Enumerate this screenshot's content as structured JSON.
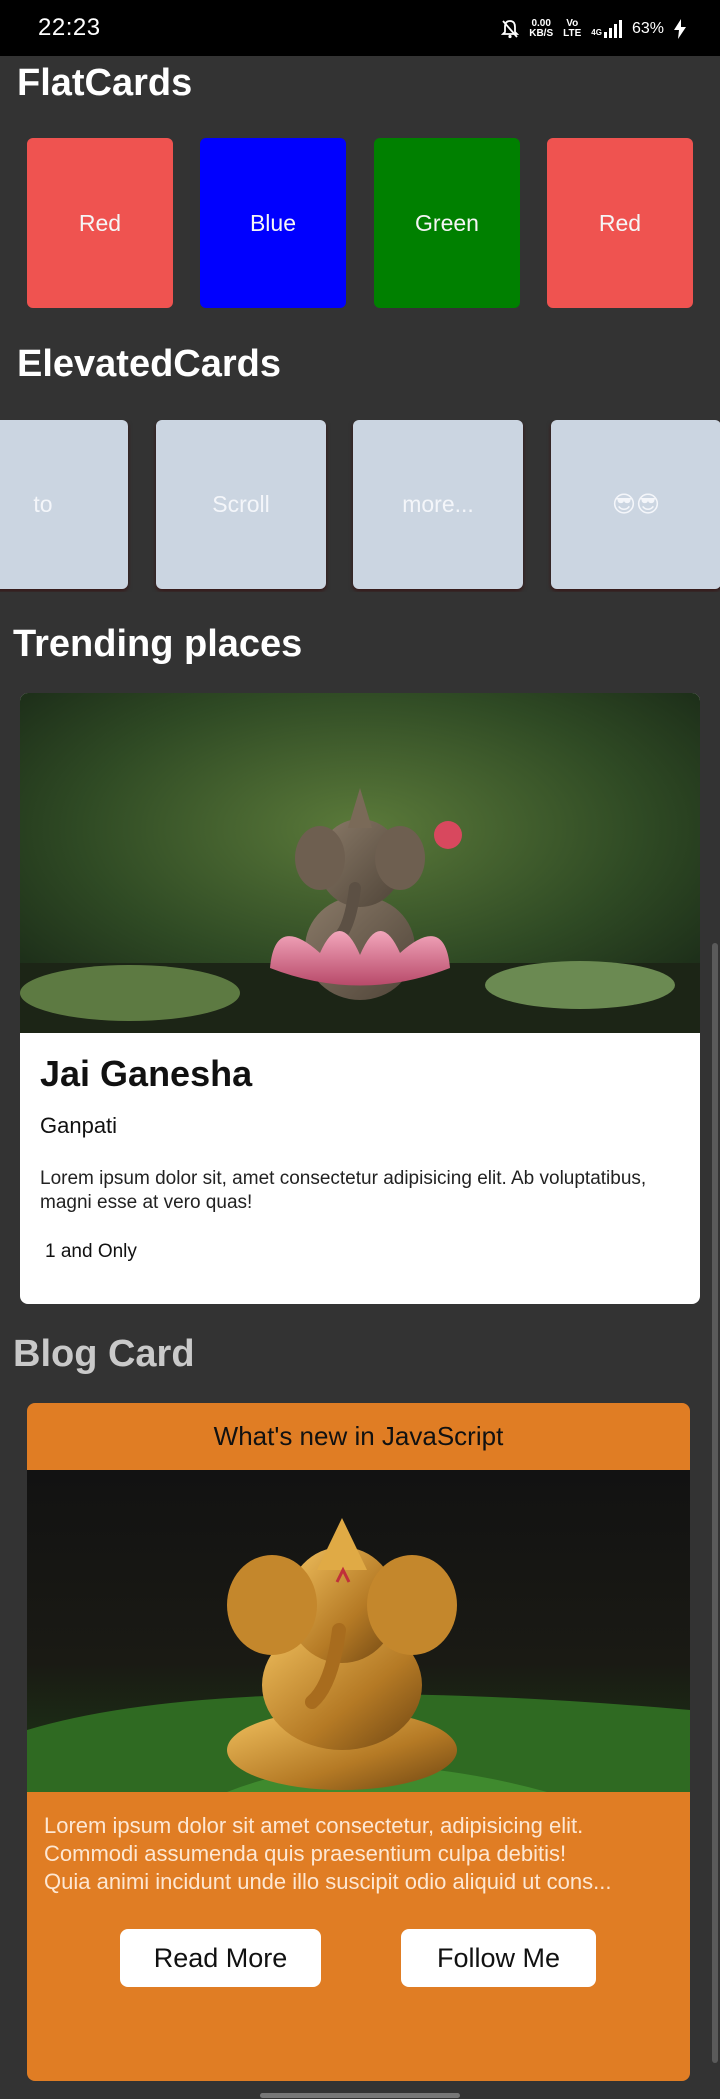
{
  "status_bar": {
    "time": "22:23",
    "net_speed_value": "0.00",
    "net_speed_unit": "KB/S",
    "volte_top": "Vo",
    "volte_bottom": "LTE",
    "network_type": "4G",
    "battery": "63%"
  },
  "sections": {
    "flat_title": "FlatCards",
    "elevated_title": "ElevatedCards",
    "trending_title": "Trending places",
    "blog_title": "Blog Card"
  },
  "flat_cards": [
    {
      "label": "Red",
      "color": "#ef5350"
    },
    {
      "label": "Blue",
      "color": "#0000ff"
    },
    {
      "label": "Green",
      "color": "#008000"
    },
    {
      "label": "Red",
      "color": "#ef5350"
    }
  ],
  "elevated_cards": [
    {
      "label": "to"
    },
    {
      "label": "Scroll"
    },
    {
      "label": "more..."
    },
    {
      "label": "😎😎"
    }
  ],
  "trending_card": {
    "title": "Jai Ganesha",
    "label": "Ganpati",
    "description": "Lorem ipsum dolor sit, amet consectetur adipisicing elit. Ab voluptatibus, magni esse at vero quas!",
    "footer": "1 and Only"
  },
  "blog_card": {
    "header": "What's new in JavaScript",
    "body_lines": [
      "Lorem ipsum dolor sit amet consectetur, adipisicing elit.",
      "Commodi assumenda quis praesentium culpa debitis!",
      "Quia animi incidunt unde illo suscipit odio aliquid ut cons..."
    ],
    "read_more": "Read More",
    "follow_me": "Follow Me"
  },
  "colors": {
    "background": "#333333",
    "blog_accent": "#e07d24",
    "elevated_card": "#cbd5e1"
  }
}
